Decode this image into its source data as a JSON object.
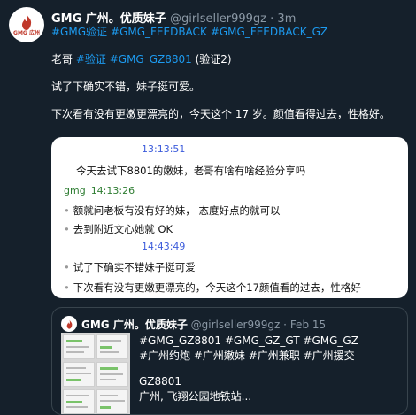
{
  "colors": {
    "background": "#15202b",
    "link": "#1d9bf0",
    "muted": "#8b98a5",
    "chat_time": "#3b5bdb",
    "chat_sender": "#2e7d32"
  },
  "tweet": {
    "avatar_logo_text": "GMG 広州",
    "author_name": "GMG 广州。优质妹子",
    "handle": "@girlseller999gz",
    "dot": "·",
    "time": "3m",
    "hashtags": [
      "#GMG验证",
      "#GMG_FEEDBACK",
      "#GMG_FEEDBACK_GZ"
    ],
    "line1_prefix": "老哥 ",
    "line1_tag1": "#验证",
    "line1_tag2": "#GMG_GZ8801",
    "line1_suffix": " (验证2)",
    "line2": "试了下确实不错，妹子挺可爱。",
    "line3": "下次看有没有更嫩更漂亮的，今天这个 17 岁。颜值看得过去，性格好。"
  },
  "chat": {
    "time1": "13:13:51",
    "msg1": "今天去试下8801的嫩妹，老哥有啥有啥经验分享吗",
    "sender": "gmg",
    "sender_time": "14:13:26",
    "bullet": "•",
    "msg2": "额就问老板有没有好的妹，  态度好点的就可以",
    "msg3": "去到附近文心她就 OK",
    "time2": "14:43:49",
    "msg4": "试了下确实不错妹子挺可爱",
    "msg5": "下次看有没有更嫩更漂亮的，今天这个17颜值看的过去，性格好"
  },
  "quote": {
    "author_name": "GMG 广州。优质妹子",
    "handle": "@girlseller999gz",
    "dot": "·",
    "time": "Feb 15",
    "line1": "#GMG_GZ8801 #GMG_GZ_GT #GMG_GZ",
    "line2": "#广州约炮 #广州嫩妹 #广州兼职 #广州援交",
    "line3": "GZ8801",
    "line4": "广州, 飞翔公园地铁站..."
  }
}
